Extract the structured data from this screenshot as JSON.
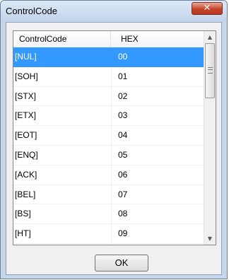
{
  "window": {
    "title": "ControlCode",
    "close_glyph": "✕"
  },
  "table": {
    "columns": [
      "ControlCode",
      "HEX"
    ],
    "rows": [
      {
        "code": "[NUL]",
        "hex": "00",
        "selected": true
      },
      {
        "code": "[SOH]",
        "hex": "01"
      },
      {
        "code": "[STX]",
        "hex": "02"
      },
      {
        "code": "[ETX]",
        "hex": "03"
      },
      {
        "code": "[EOT]",
        "hex": "04"
      },
      {
        "code": "[ENQ]",
        "hex": "05"
      },
      {
        "code": "[ACK]",
        "hex": "06"
      },
      {
        "code": "[BEL]",
        "hex": "07"
      },
      {
        "code": "[BS]",
        "hex": "08"
      },
      {
        "code": "[HT]",
        "hex": "09"
      }
    ]
  },
  "scrollbar": {
    "up_icon": "scroll-up-arrow-icon",
    "down_icon": "scroll-down-arrow-icon",
    "up_glyph": "▲",
    "down_glyph": "▼"
  },
  "buttons": {
    "ok_label": "OK"
  },
  "colors": {
    "selection": "#3399ff",
    "close_button": "#c7432a"
  }
}
